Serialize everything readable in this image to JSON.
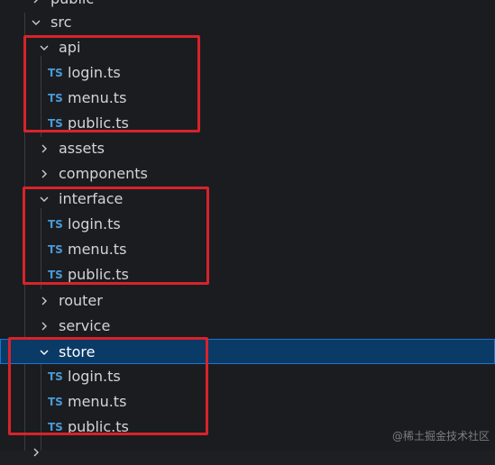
{
  "tree": {
    "top_folder": {
      "label": "public",
      "expanded": false
    },
    "src": {
      "label": "src",
      "expanded": true,
      "children": {
        "api": {
          "label": "api",
          "expanded": true,
          "files": [
            {
              "badge": "TS",
              "name": "login.ts"
            },
            {
              "badge": "TS",
              "name": "menu.ts"
            },
            {
              "badge": "TS",
              "name": "public.ts"
            }
          ]
        },
        "assets": {
          "label": "assets",
          "expanded": false
        },
        "components": {
          "label": "components",
          "expanded": false
        },
        "interface": {
          "label": "interface",
          "expanded": true,
          "files": [
            {
              "badge": "TS",
              "name": "login.ts"
            },
            {
              "badge": "TS",
              "name": "menu.ts"
            },
            {
              "badge": "TS",
              "name": "public.ts"
            }
          ]
        },
        "router": {
          "label": "router",
          "expanded": false
        },
        "service": {
          "label": "service",
          "expanded": false
        },
        "store": {
          "label": "store",
          "expanded": true,
          "selected": true,
          "files": [
            {
              "badge": "TS",
              "name": "login.ts"
            },
            {
              "badge": "TS",
              "name": "menu.ts"
            },
            {
              "badge": "TS",
              "name": "public.ts"
            }
          ]
        }
      }
    }
  },
  "colors": {
    "background": "#1b1c20",
    "selection": "#0a3a66",
    "selection_border": "#1b74d1",
    "ts_badge": "#4a9bd6",
    "highlight_box": "#d8232a"
  },
  "watermark": "@稀土掘金技术社区"
}
